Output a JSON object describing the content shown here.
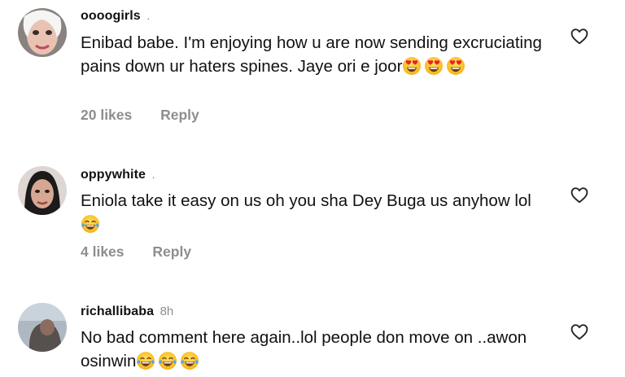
{
  "comments": [
    {
      "username": "oooogirls",
      "dot": ".",
      "text": "Enibad babe. I'm enjoying how u are now sending excruciating pains down ur haters spines. Jaye ori e joor",
      "emojis": [
        "heart-eyes",
        "heart-eyes",
        "heart-eyes"
      ],
      "likes": "20 likes",
      "reply": "Reply"
    },
    {
      "username": "oppywhite",
      "dot": ".",
      "text": "Eniola take it easy on us oh you sha Dey Buga us anyhow lol",
      "emojis": [
        "tears-of-joy"
      ],
      "likes": "4 likes",
      "reply": "Reply"
    },
    {
      "username": "richallibaba",
      "time": "8h",
      "text": "No bad comment here again..lol people don move on ..awon osinwin",
      "emojis": [
        "tears-of-joy",
        "tears-of-joy",
        "tears-of-joy"
      ]
    }
  ],
  "icons": {
    "like": "heart-outline-icon"
  },
  "colors": {
    "muted": "#8e8e8e",
    "text": "#111111"
  }
}
